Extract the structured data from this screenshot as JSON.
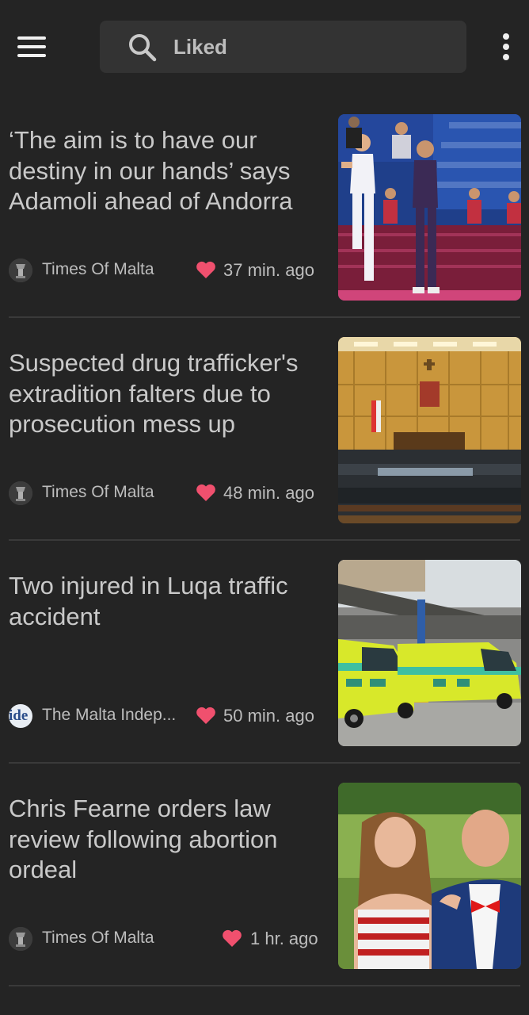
{
  "topbar": {
    "menu_icon": "hamburger-menu-icon",
    "search_icon": "search-icon",
    "search_text": "Liked",
    "more_icon": "more-vertical-icon"
  },
  "colors": {
    "background": "#242424",
    "heart": "#f0506e",
    "text": "#c9c9c9"
  },
  "articles": [
    {
      "headline": "‘The aim is to have our destiny in our hands’ says Adamoli ahead of Andorra",
      "source": "Times Of Malta",
      "time": "37 min. ago"
    },
    {
      "headline": "Suspected drug trafficker's extradition falters due to prosecution mess up",
      "source": "Times Of Malta",
      "time": "48 min. ago"
    },
    {
      "headline": "Two injured in Luqa traffic accident",
      "source": "The Malta Indep...",
      "time": "50 min. ago"
    },
    {
      "headline": "Chris Fearne orders law review following abortion ordeal",
      "source": "Times Of Malta",
      "time": "1 hr. ago"
    }
  ]
}
